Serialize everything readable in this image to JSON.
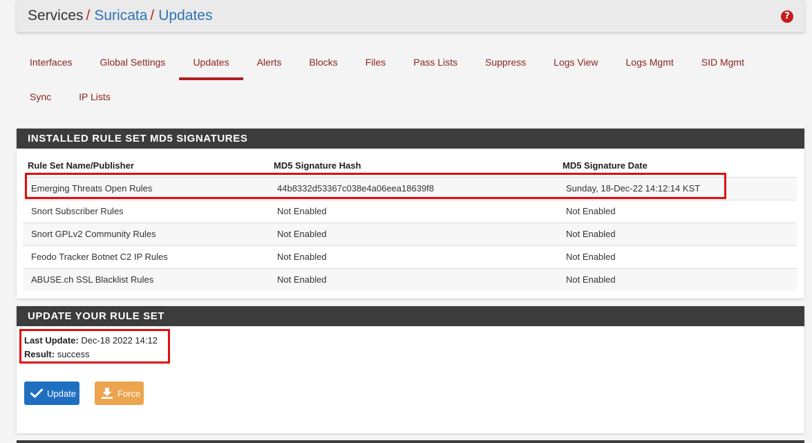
{
  "breadcrumb": {
    "root": "Services",
    "separator": "/",
    "items": [
      "Suricata",
      "Updates"
    ]
  },
  "help_icon": "question-circle-icon",
  "tabs_row1": [
    "Interfaces",
    "Global Settings",
    "Updates",
    "Alerts",
    "Blocks",
    "Files",
    "Pass Lists",
    "Suppress",
    "Logs View",
    "Logs Mgmt",
    "SID Mgmt"
  ],
  "tabs_row2": [
    "Sync",
    "IP Lists"
  ],
  "active_tab": "Updates",
  "md5_panel": {
    "title": "INSTALLED RULE SET MD5 SIGNATURES",
    "headers": [
      "Rule Set Name/Publisher",
      "MD5 Signature Hash",
      "MD5 Signature Date"
    ],
    "rows": [
      [
        "Emerging Threats Open Rules",
        "44b8332d53367c038e4a06eea18639f8",
        "Sunday, 18-Dec-22 14:12:14 KST"
      ],
      [
        "Snort Subscriber Rules",
        "Not Enabled",
        "Not Enabled"
      ],
      [
        "Snort GPLv2 Community Rules",
        "Not Enabled",
        "Not Enabled"
      ],
      [
        "Feodo Tracker Botnet C2 IP Rules",
        "Not Enabled",
        "Not Enabled"
      ],
      [
        "ABUSE.ch SSL Blacklist Rules",
        "Not Enabled",
        "Not Enabled"
      ]
    ]
  },
  "update_panel": {
    "title": "UPDATE YOUR RULE SET",
    "last_update_label": "Last Update:",
    "last_update_value": "Dec-18 2022 14:12",
    "result_label": "Result:",
    "result_value": "success",
    "update_button": "Update",
    "force_button": "Force"
  },
  "colors": {
    "accent_red": "#b31d1d",
    "link_blue": "#2d72b6",
    "update_button": "#1f6fc0",
    "force_button": "#eca54e",
    "highlight_box": "#e00d0d"
  }
}
